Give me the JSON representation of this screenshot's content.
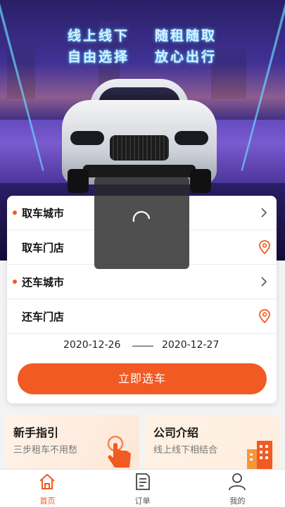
{
  "banner": {
    "line1_left": "线上线下",
    "line1_right": "随租随取",
    "line2_left": "自由选择",
    "line2_right": "放心出行"
  },
  "booking": {
    "pickup_city_label": "取车城市",
    "pickup_store_label": "取车门店",
    "return_city_label": "还车城市",
    "return_store_label": "还车门店",
    "pickup_date": "2020-12-26",
    "return_date": "2020-12-27",
    "submit_label": "立即选车"
  },
  "tiles": [
    {
      "title": "新手指引",
      "subtitle": "三步租车不用愁",
      "icon": "hand-tap-icon"
    },
    {
      "title": "公司介绍",
      "subtitle": "线上线下相结合",
      "icon": "building-icon"
    }
  ],
  "tabbar": {
    "items": [
      {
        "label": "首页",
        "icon": "home-icon",
        "active": true
      },
      {
        "label": "订单",
        "icon": "order-icon",
        "active": false
      },
      {
        "label": "我的",
        "icon": "user-icon",
        "active": false
      }
    ]
  },
  "colors": {
    "accent": "#f15a22",
    "loader_bg": "#282828"
  }
}
